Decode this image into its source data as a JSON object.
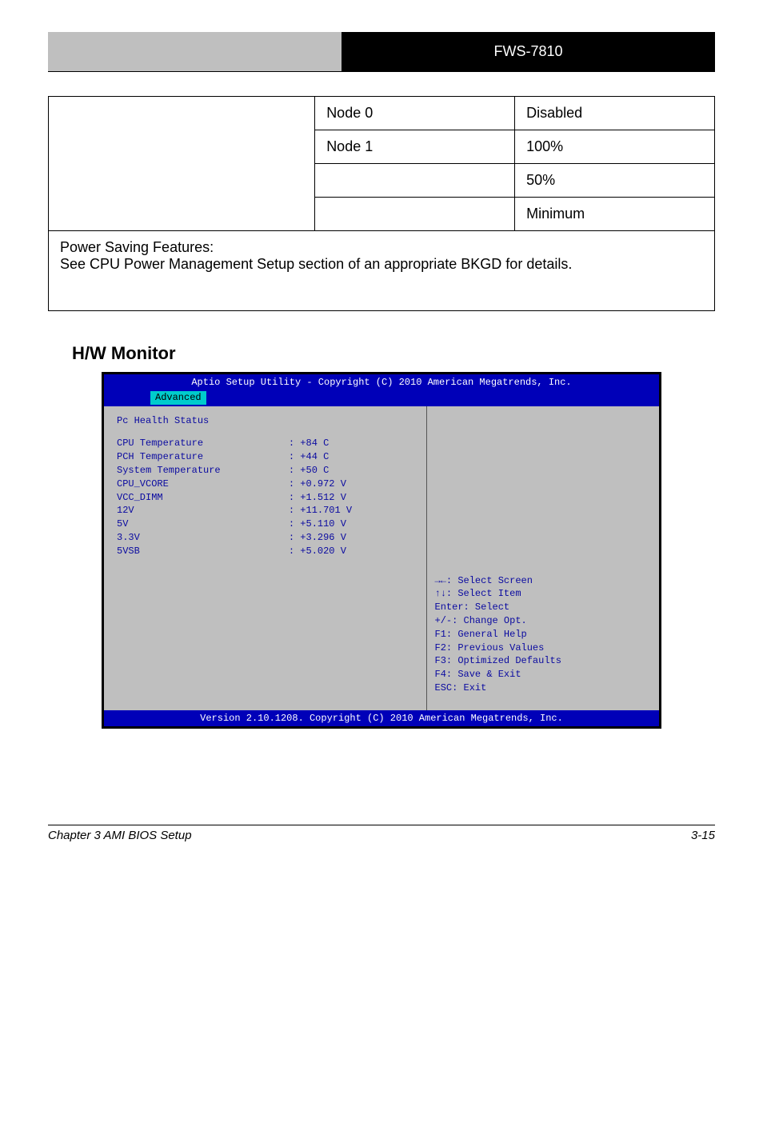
{
  "header": {
    "right_text": "FWS-7810"
  },
  "table": {
    "node0_label": "Node 0",
    "node1_label": "Node 1",
    "disabled": "Disabled",
    "hundred": "100%",
    "fifty": "50%",
    "minimum": "Minimum",
    "desc_title": "Power Saving Features:",
    "desc_body": "See CPU Power Management Setup section of an appropriate BKGD for details."
  },
  "section_title": "H/W Monitor",
  "bios": {
    "top_title": "Aptio Setup Utility - Copyright (C) 2010 American Megatrends, Inc.",
    "tab": "Advanced",
    "pc_health": "Pc Health Status",
    "stats": [
      {
        "label": "CPU Temperature",
        "value": ": +84 C"
      },
      {
        "label": "PCH Temperature",
        "value": ": +44 C"
      },
      {
        "label": "System Temperature",
        "value": ": +50 C"
      },
      {
        "label": "CPU_VCORE",
        "value": ": +0.972 V"
      },
      {
        "label": "VCC_DIMM",
        "value": ": +1.512 V"
      },
      {
        "label": "12V",
        "value": ": +11.701 V"
      },
      {
        "label": "5V",
        "value": ": +5.110 V"
      },
      {
        "label": "3.3V",
        "value": ": +3.296 V"
      },
      {
        "label": "5VSB",
        "value": ": +5.020 V"
      }
    ],
    "help": [
      "→←: Select Screen",
      "↑↓: Select Item",
      "Enter: Select",
      "+/-: Change Opt.",
      "F1: General Help",
      "F2: Previous Values",
      "F3: Optimized Defaults",
      "F4: Save & Exit",
      "ESC: Exit"
    ],
    "bottom": "Version 2.10.1208. Copyright (C) 2010 American Megatrends, Inc."
  },
  "footer": {
    "left": "Chapter 3 AMI BIOS Setup",
    "right": "3-15"
  }
}
